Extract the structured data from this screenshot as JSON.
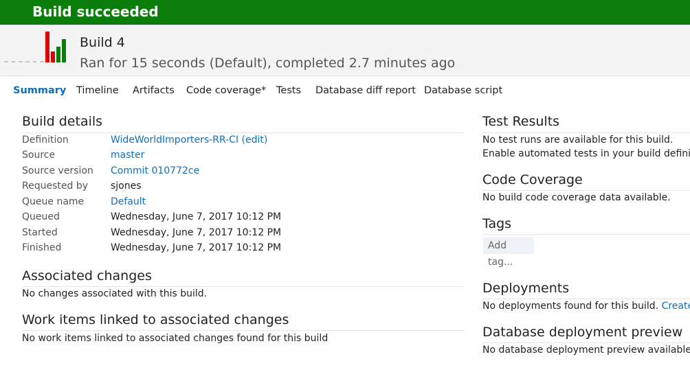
{
  "banner": {
    "title": "Build succeeded"
  },
  "header": {
    "build_name": "Build 4",
    "subtitle": "Ran for 15 seconds (Default), completed 2.7 minutes ago"
  },
  "tabs": [
    {
      "label": "Summary",
      "active": true
    },
    {
      "label": "Timeline"
    },
    {
      "label": "Artifacts"
    },
    {
      "label": "Code coverage*"
    },
    {
      "label": "Tests"
    },
    {
      "label": "Database diff report"
    },
    {
      "label": "Database script"
    }
  ],
  "build_details": {
    "title": "Build details",
    "rows": [
      {
        "label": "Definition",
        "value": "WideWorldImporters-RR-CI (edit)"
      },
      {
        "label": "Source",
        "value": "master"
      },
      {
        "label": "Source version",
        "value": "Commit 010772ce"
      },
      {
        "label": "Requested by",
        "value": "sjones"
      },
      {
        "label": "Queue name",
        "value": "Default"
      },
      {
        "label": "Queued",
        "value": "Wednesday, June 7, 2017 10:12 PM"
      },
      {
        "label": "Started",
        "value": "Wednesday, June 7, 2017 10:12 PM"
      },
      {
        "label": "Finished",
        "value": "Wednesday, June 7, 2017 10:12 PM"
      }
    ]
  },
  "associated_changes": {
    "title": "Associated changes",
    "text": "No changes associated with this build."
  },
  "work_items": {
    "title": "Work items linked to associated changes",
    "text": "No work items linked to associated changes found for this build"
  },
  "test_results": {
    "title": "Test Results",
    "line1": "No test runs are available for this build.",
    "line2": "Enable automated tests in your build definition"
  },
  "code_coverage": {
    "title": "Code Coverage",
    "text": "No build code coverage data available."
  },
  "tags": {
    "title": "Tags",
    "add_tag": "Add tag..."
  },
  "deployments": {
    "title": "Deployments",
    "text": "No deployments found for this build.",
    "link": "Create r"
  },
  "db_preview": {
    "title": "Database deployment preview",
    "text": "No database deployment preview available in"
  },
  "colors": {
    "success": "#0b7d0b",
    "failure": "#e00000",
    "link": "#106ebe"
  }
}
